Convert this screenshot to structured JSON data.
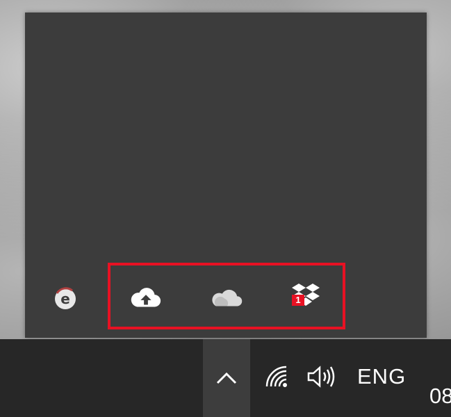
{
  "hidden_icons_flyout": {
    "icons": [
      {
        "name": "ie-updater-icon",
        "letter": "e"
      },
      {
        "name": "cloud-upload-icon"
      },
      {
        "name": "onedrive-icon"
      },
      {
        "name": "dropbox-icon",
        "badge": "1"
      }
    ],
    "highlight_color": "#e81123"
  },
  "taskbar": {
    "show_hidden_icons": "chevron-up-icon",
    "network": "wifi-icon",
    "volume": "speaker-icon",
    "language": "ENG",
    "clock_partial": "08"
  },
  "colors": {
    "flyout_bg": "#3c3c3c",
    "taskbar_bg": "#272727",
    "chevron_bg": "#3d3d3d",
    "badge_bg": "#e81123"
  }
}
